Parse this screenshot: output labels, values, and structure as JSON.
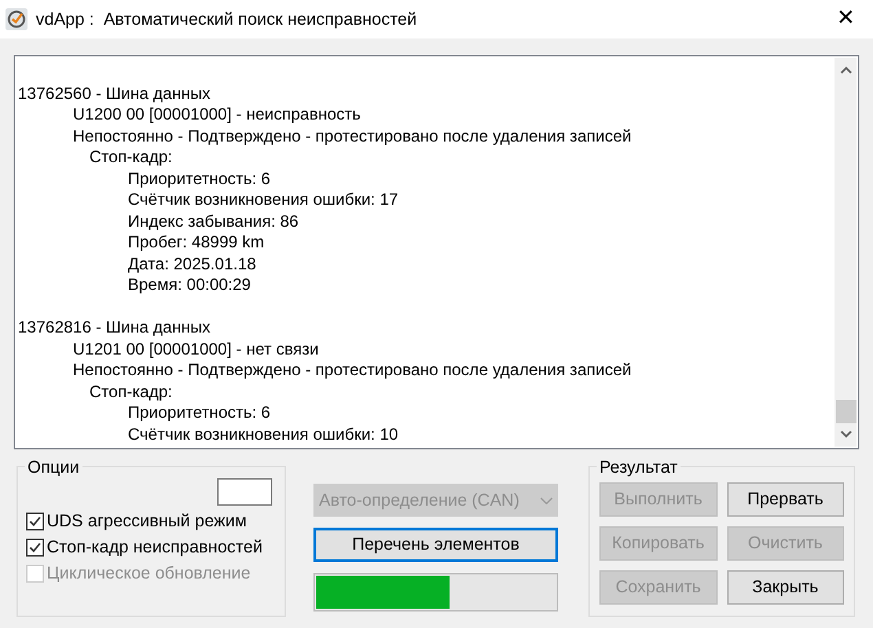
{
  "window": {
    "title": "vdApp :  Автоматический поиск неисправностей",
    "close": "✕"
  },
  "log": [
    {
      "text": "13762560 - Шина данных",
      "children": [
        {
          "text": "U1200 00 [00001000] - неисправность"
        },
        {
          "text": "Непостоянно - Подтверждено - протестировано после удаления записей",
          "children": [
            {
              "text": "Стоп-кадр:",
              "children": [
                {
                  "text": "Приоритетность: 6"
                },
                {
                  "text": "Счётчик возникновения ошибки: 17"
                },
                {
                  "text": "Индекс забывания: 86"
                },
                {
                  "text": "Пробег: 48999 km"
                },
                {
                  "text": "Дата: 2025.01.18"
                },
                {
                  "text": "Время: 00:00:29"
                }
              ]
            }
          ]
        }
      ]
    },
    {
      "text": "13762816 - Шина данных",
      "children": [
        {
          "text": "U1201 00 [00001000] - нет связи"
        },
        {
          "text": "Непостоянно - Подтверждено - протестировано после удаления записей",
          "children": [
            {
              "text": "Стоп-кадр:",
              "children": [
                {
                  "text": "Приоритетность: 6"
                },
                {
                  "text": "Счётчик возникновения ошибки: 10"
                }
              ]
            }
          ]
        }
      ]
    }
  ],
  "options": {
    "title": "Опции",
    "checkboxes": [
      {
        "label": "UDS агрессивный режим",
        "checked": true,
        "disabled": false
      },
      {
        "label": "Стоп-кадр неисправностей",
        "checked": true,
        "disabled": false
      },
      {
        "label": "Циклическое обновление",
        "checked": false,
        "disabled": true
      }
    ]
  },
  "protocol": {
    "value": "Авто-определение (CAN)",
    "disabled": true
  },
  "list_button": {
    "label": "Перечень элементов",
    "focused": true
  },
  "progress": {
    "level": 0.56
  },
  "result": {
    "title": "Результат",
    "buttons": [
      {
        "label": "Выполнить",
        "disabled": true
      },
      {
        "label": "Прервать",
        "disabled": false
      },
      {
        "label": "Копировать",
        "disabled": true
      },
      {
        "label": "Очистить",
        "disabled": true
      },
      {
        "label": "Сохранить",
        "disabled": true
      },
      {
        "label": "Закрыть",
        "disabled": false
      }
    ]
  }
}
